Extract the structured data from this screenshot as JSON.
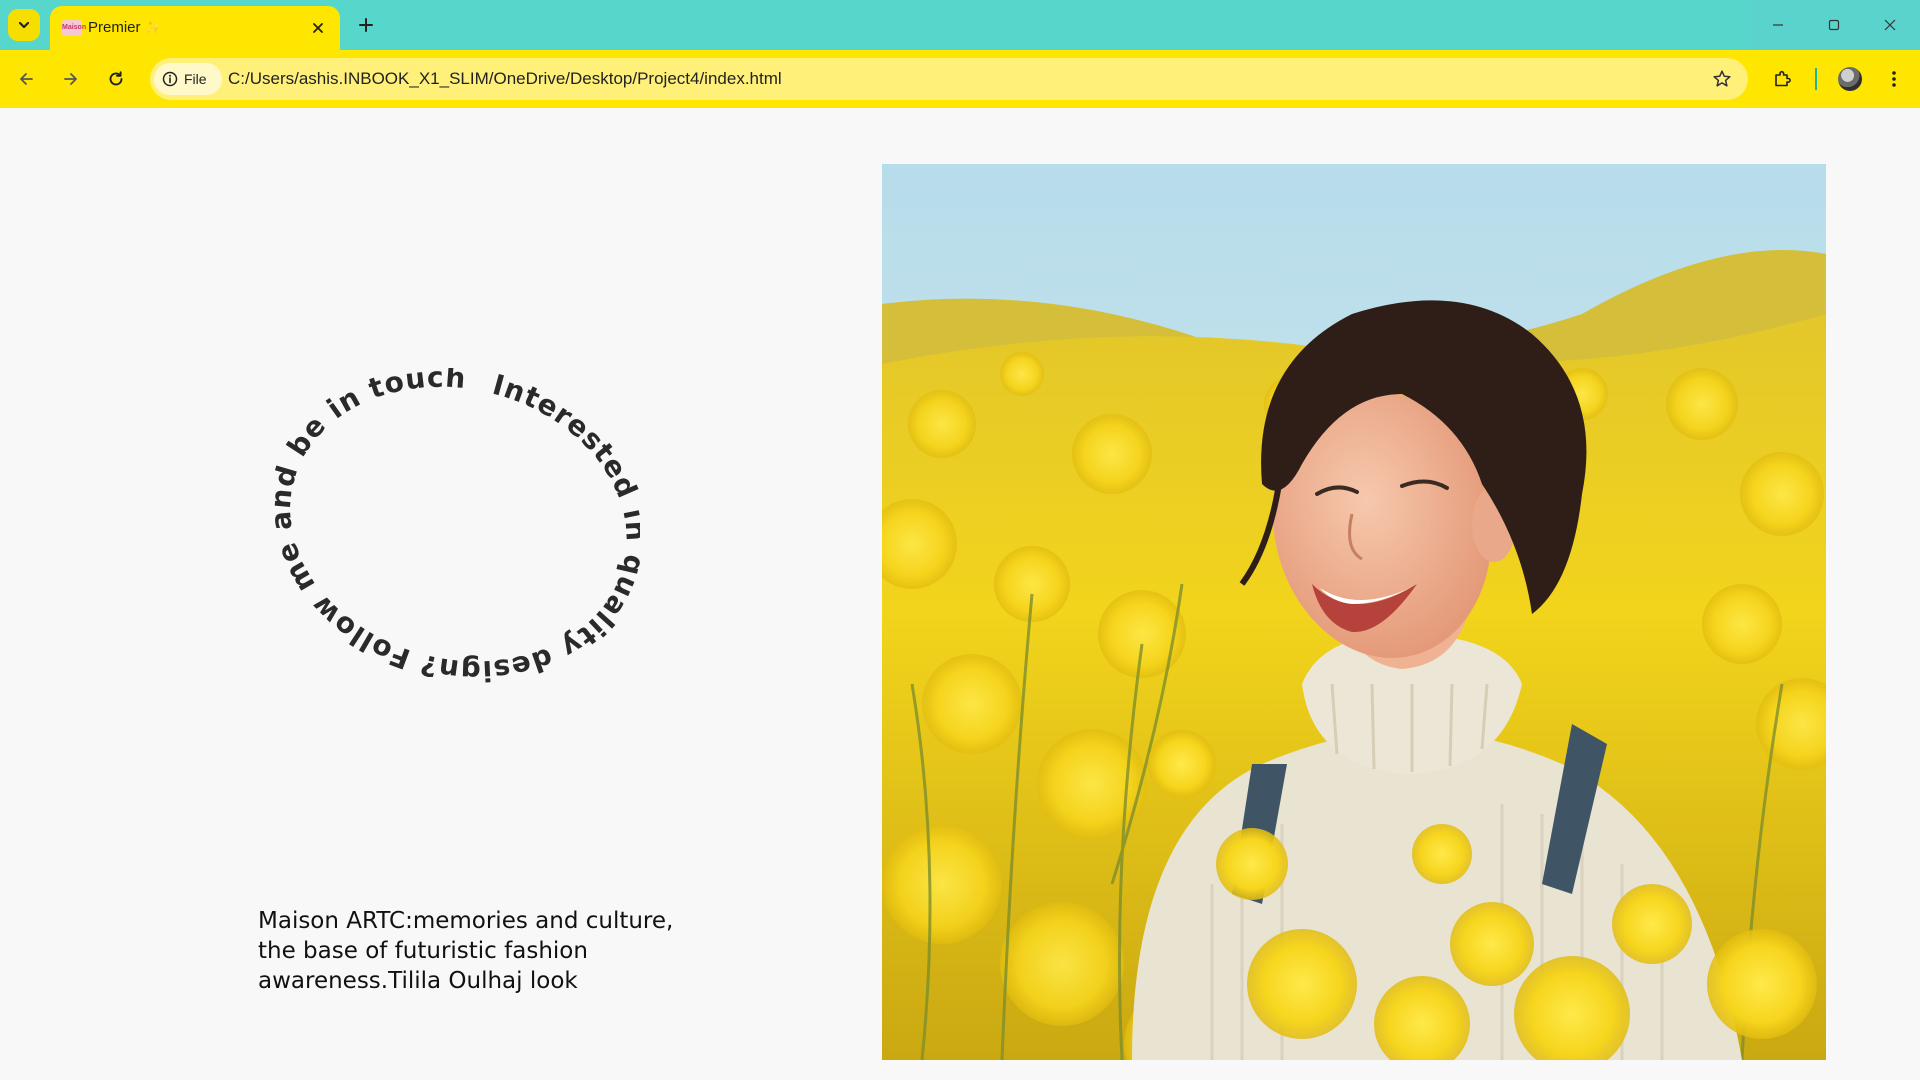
{
  "browser": {
    "tab": {
      "title": "Premier",
      "title_decoration": "✨",
      "favicon_text": "Maison"
    },
    "omnibox": {
      "chip_label": "File",
      "url": "C:/Users/ashis.INBOOK_X1_SLIM/OneDrive/Desktop/Project4/index.html"
    },
    "colors": {
      "titlebar": "#57d6cc",
      "toolbar": "#ffe600",
      "omnibox": "#fff07a"
    }
  },
  "page": {
    "circle_text": "Interested in quality design? Follow me and be in touch ",
    "caption_lines": [
      "Maison ARTC:memories and culture,",
      "the base of futuristic fashion",
      "awareness.Tilila Oulhaj look"
    ],
    "photo": {
      "subject": "smiling woman in yellow flower field",
      "palette": {
        "sky": "#bfe0ea",
        "field": "#f3d21a",
        "sweater": "#e9e3d2",
        "hair": "#2e1e17"
      }
    }
  }
}
